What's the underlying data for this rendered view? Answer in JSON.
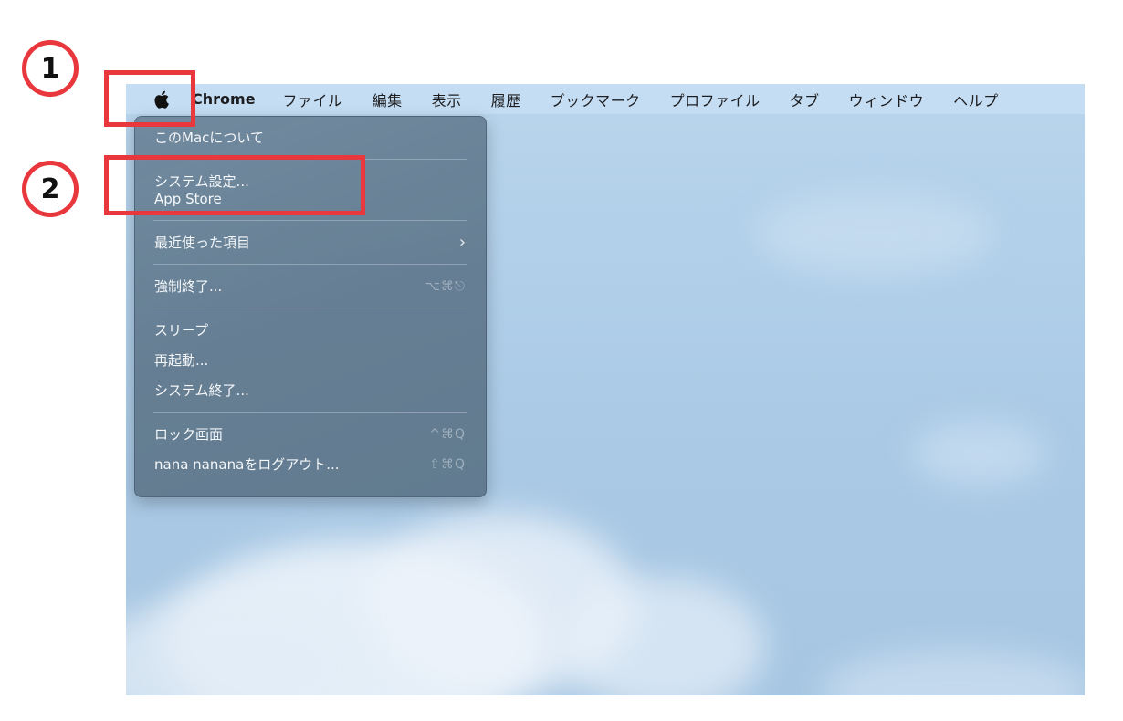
{
  "menubar": {
    "app_name": "Chrome",
    "menus": [
      "ファイル",
      "編集",
      "表示",
      "履歴",
      "ブックマーク",
      "プロファイル",
      "タブ",
      "ウィンドウ",
      "ヘルプ"
    ]
  },
  "apple_menu": {
    "about": "このMacについて",
    "system_settings": "システム設定...",
    "app_store": "App Store",
    "recent_items": "最近使った項目",
    "force_quit": "強制終了...",
    "force_quit_shortcut": "⌥⌘⎋",
    "sleep": "スリープ",
    "restart": "再起動...",
    "shutdown": "システム終了...",
    "lock_screen": "ロック画面",
    "lock_screen_shortcut": "^⌘Q",
    "logout": "nana nananaをログアウト...",
    "logout_shortcut": "⇧⌘Q"
  },
  "annotations": {
    "step1": "1",
    "step2": "2"
  },
  "colors": {
    "annotation_red": "#e8383d",
    "menubar": "#c5ddf2",
    "menu_background": "#60788c"
  }
}
